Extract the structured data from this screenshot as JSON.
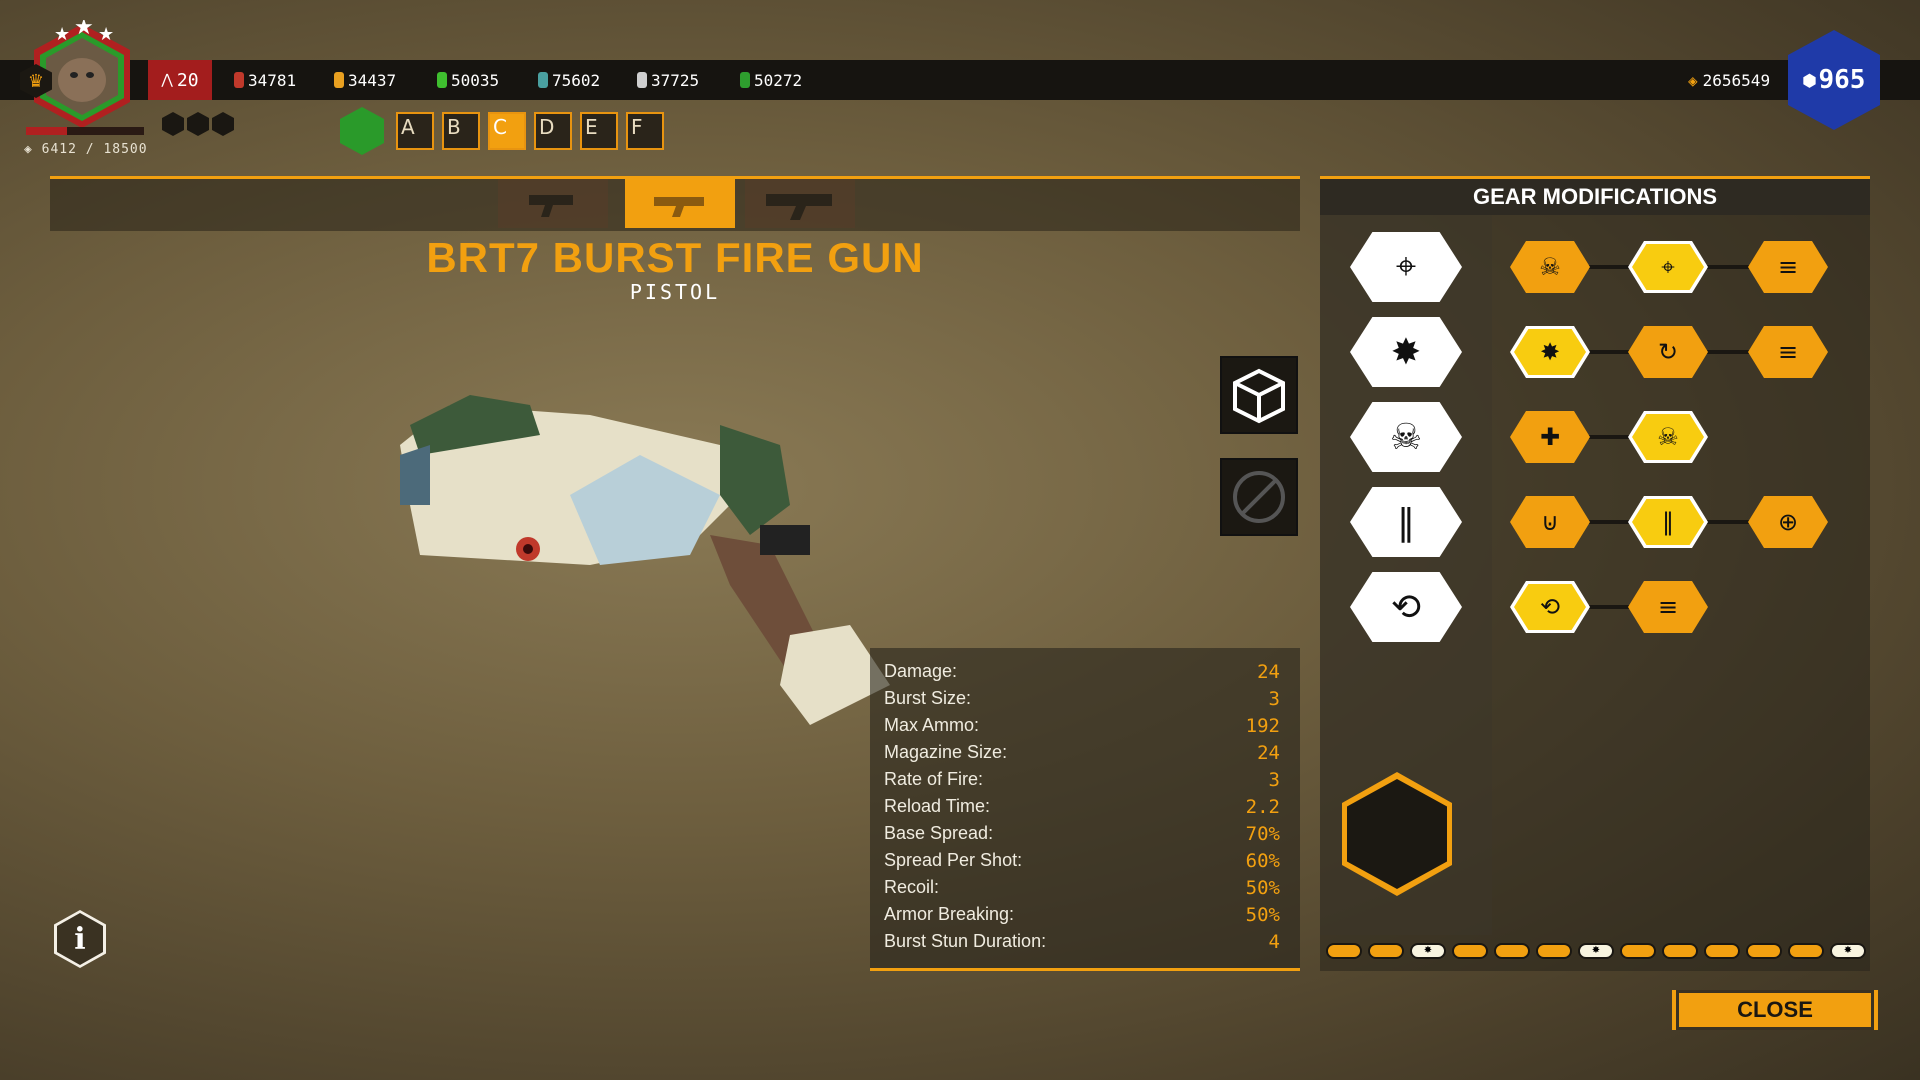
{
  "hud": {
    "player_level": "20",
    "xp": "6412 / 18500",
    "level_progress": 0.35,
    "resources": [
      {
        "name": "red-resource",
        "value": "34781",
        "color": "#c0392b"
      },
      {
        "name": "gold-resource",
        "value": "34437",
        "color": "#e8a020"
      },
      {
        "name": "green-resource",
        "value": "50035",
        "color": "#3fbf2f"
      },
      {
        "name": "teal-resource",
        "value": "75602",
        "color": "#4aa0a0"
      },
      {
        "name": "silver-resource",
        "value": "37725",
        "color": "#cfcfcf"
      },
      {
        "name": "plant-resource",
        "value": "50272",
        "color": "#2e9e2e"
      }
    ],
    "gems": "2656549",
    "premium_currency": "965",
    "loadout_slots": [
      "A",
      "B",
      "C",
      "D",
      "E",
      "F"
    ],
    "selected_slot": "C"
  },
  "weapon": {
    "name": "BRT7 BURST FIRE GUN",
    "type": "PISTOL",
    "selected_tab": 1
  },
  "stats": [
    {
      "label": "Damage:",
      "value": "24"
    },
    {
      "label": "Burst Size:",
      "value": "3"
    },
    {
      "label": "Max Ammo:",
      "value": "192"
    },
    {
      "label": "Magazine Size:",
      "value": "24"
    },
    {
      "label": "Rate of Fire:",
      "value": "3"
    },
    {
      "label": "Reload Time:",
      "value": "2.2"
    },
    {
      "label": "Base Spread:",
      "value": "70%"
    },
    {
      "label": "Spread Per Shot:",
      "value": "60%"
    },
    {
      "label": "Recoil:",
      "value": "50%"
    },
    {
      "label": "Armor Breaking:",
      "value": "50%"
    },
    {
      "label": "Burst Stun Duration:",
      "value": "4"
    }
  ],
  "gear": {
    "title": "GEAR MODIFICATIONS",
    "tiers": [
      {
        "category": "accuracy-icon",
        "mods": [
          {
            "icon": "skull-icon",
            "selected": false
          },
          {
            "icon": "crosshair-icon",
            "selected": true
          },
          {
            "icon": "bullets-icon",
            "selected": false
          }
        ]
      },
      {
        "category": "impact-icon",
        "mods": [
          {
            "icon": "impact-icon",
            "selected": true
          },
          {
            "icon": "reload-icon",
            "selected": false
          },
          {
            "icon": "bullets-icon",
            "selected": false
          }
        ]
      },
      {
        "category": "skull-icon",
        "mods": [
          {
            "icon": "ammo-plus-icon",
            "selected": false
          },
          {
            "icon": "skull-icon",
            "selected": true
          }
        ]
      },
      {
        "category": "ammo-icon",
        "mods": [
          {
            "icon": "magazine-icon",
            "selected": false
          },
          {
            "icon": "ammo-icon",
            "selected": true
          },
          {
            "icon": "target-skull-icon",
            "selected": false
          }
        ]
      },
      {
        "category": "overclock-icon",
        "mods": [
          {
            "icon": "overclock-icon",
            "selected": true
          },
          {
            "icon": "bullets-icon",
            "selected": false
          }
        ]
      }
    ],
    "pips": [
      false,
      false,
      true,
      false,
      false,
      false,
      true,
      false,
      false,
      false,
      false,
      false,
      true
    ]
  },
  "close_label": "CLOSE"
}
